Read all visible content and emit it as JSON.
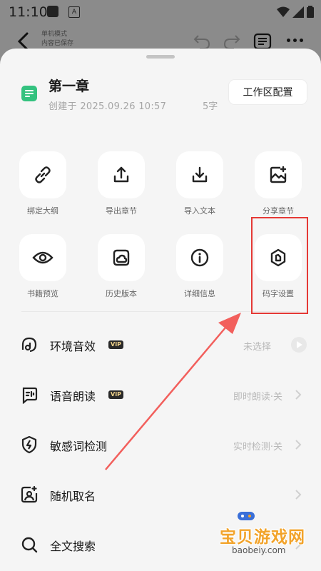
{
  "status_bar": {
    "time": "11:10",
    "app_indicator": "A"
  },
  "top_bar": {
    "doc_hint_line1": "单机模式",
    "doc_hint_line2": "内容已保存"
  },
  "chapter": {
    "title": "第一章",
    "created": "创建于 2025.09.26 10:57",
    "word_count": "5字",
    "workspace_button": "工作区配置"
  },
  "actions": [
    {
      "label": "绑定大纲",
      "icon": "link-icon"
    },
    {
      "label": "导出章节",
      "icon": "export-icon"
    },
    {
      "label": "导入文本",
      "icon": "import-icon"
    },
    {
      "label": "分享章节",
      "icon": "share-image-icon"
    },
    {
      "label": "书籍预览",
      "icon": "eye-icon"
    },
    {
      "label": "历史版本",
      "icon": "history-icon"
    },
    {
      "label": "详细信息",
      "icon": "info-icon"
    },
    {
      "label": "码字设置",
      "icon": "hexagon-settings-icon"
    }
  ],
  "settings": [
    {
      "label": "环境音效",
      "badge": "VIP",
      "value": "未选择",
      "icon": "ambient-sound-icon"
    },
    {
      "label": "语音朗读",
      "badge": "VIP",
      "value": "即时朗读·关",
      "icon": "voice-read-icon"
    },
    {
      "label": "敏感词检测",
      "value": "实时检测·关",
      "icon": "shield-bolt-icon"
    },
    {
      "label": "随机取名",
      "value": "",
      "icon": "random-name-icon"
    },
    {
      "label": "全文搜索",
      "value": "",
      "icon": "search-icon"
    }
  ],
  "watermark": {
    "text": "宝贝游戏网",
    "url": "baobeiy.com"
  },
  "colors": {
    "accent_green": "#33c27f",
    "highlight_red": "#e53935",
    "watermark_orange": "#f2a32a"
  }
}
